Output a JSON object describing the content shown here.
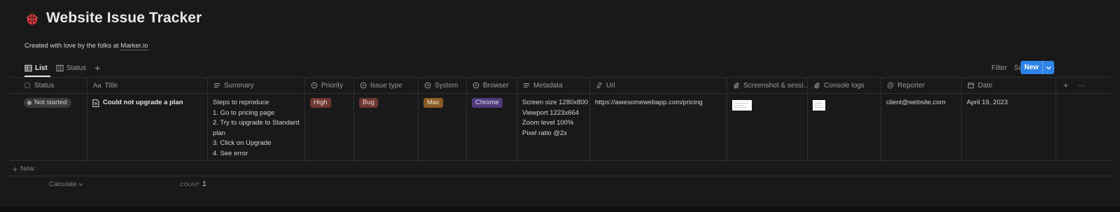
{
  "page": {
    "title": "Website Issue Tracker",
    "subtitle_prefix": "Created with love by the folks at ",
    "subtitle_link": "Marker.io"
  },
  "views": {
    "tabs": [
      {
        "label": "List",
        "active": true
      },
      {
        "label": "Status",
        "active": false
      }
    ],
    "add": "+"
  },
  "toolbar": {
    "filter": "Filter",
    "sort": "Sort",
    "more": "···",
    "new_label": "New"
  },
  "columns": [
    {
      "label": "Status",
      "icon": "status-icon"
    },
    {
      "label": "Title",
      "icon": "text-aa-icon"
    },
    {
      "label": "Summary",
      "icon": "lines-icon"
    },
    {
      "label": "Priority",
      "icon": "select-icon"
    },
    {
      "label": "Issue type",
      "icon": "select-icon"
    },
    {
      "label": "System",
      "icon": "select-icon"
    },
    {
      "label": "Browser",
      "icon": "select-icon"
    },
    {
      "label": "Metadata",
      "icon": "lines-icon"
    },
    {
      "label": "Url",
      "icon": "link-icon"
    },
    {
      "label": "Screenshot & sessi...",
      "icon": "paperclip-icon"
    },
    {
      "label": "Console logs",
      "icon": "paperclip-icon"
    },
    {
      "label": "Reporter",
      "icon": "at-icon"
    },
    {
      "label": "Date",
      "icon": "calendar-icon"
    }
  ],
  "header_actions": {
    "add": "+",
    "more": "···"
  },
  "rows": [
    {
      "status": "Not started",
      "title": "Could not upgrade a plan",
      "summary": [
        "Steps to reproduce",
        "1. Go to pricing page",
        "2. Try to upgrade to Standard",
        "plan",
        "3. Click on Upgrade",
        "4. See error"
      ],
      "priority": "High",
      "issue_type": "Bug",
      "system": "Mac",
      "browser": "Chrome",
      "metadata": [
        "Screen size 1280x800",
        "Viewport 1223x664",
        "Zoom level 100%",
        "Pixel ratio @2x"
      ],
      "url": "https://awesomewebapp.com/pricing",
      "reporter": "client@website.com",
      "date": "April 19, 2023"
    }
  ],
  "footer": {
    "new_row": "New",
    "calculate": "Calculate",
    "count_label": "COUNT",
    "count_value": "1"
  },
  "colors": {
    "priority_high": "#6e3630",
    "issue_bug": "#6e3630",
    "system_mac": "#8a5a26",
    "browser_chrome": "#4f3a7a",
    "accent": "#2e83e6"
  }
}
